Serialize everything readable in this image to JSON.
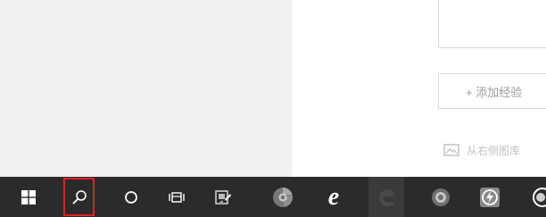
{
  "content": {
    "add_experience_label": "+ 添加经验",
    "pick_image_label": "从右侧图库"
  },
  "taskbar": {
    "items": [
      {
        "icon": "windows-start-icon"
      },
      {
        "icon": "search-icon",
        "highlighted": true
      },
      {
        "icon": "cortana-icon"
      },
      {
        "icon": "task-view-icon"
      },
      {
        "icon": "photo-editor-app-icon"
      },
      {
        "icon": "chrome-variant-app-icon"
      },
      {
        "icon": "internet-explorer-icon"
      },
      {
        "icon": "edge-icon"
      },
      {
        "icon": "browser-app-icon"
      },
      {
        "icon": "360-browser-icon"
      },
      {
        "icon": "app-icon"
      }
    ]
  },
  "colors": {
    "taskbar": "#2b2b2b",
    "highlight": "#e02020",
    "left_panel": "#f0f0f0"
  }
}
